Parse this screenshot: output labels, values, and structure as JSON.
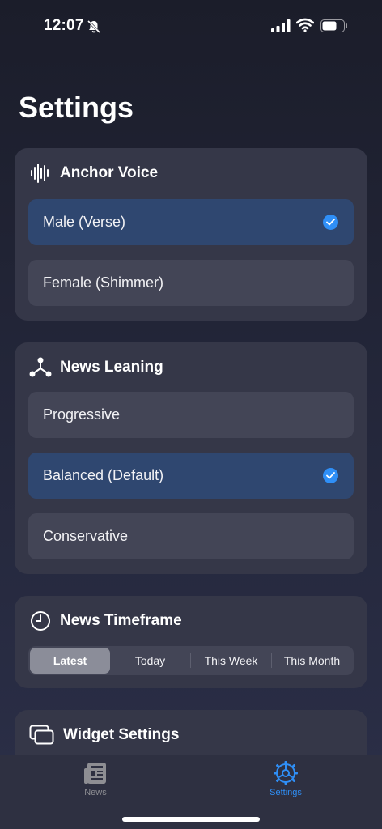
{
  "status_bar": {
    "time": "12:07"
  },
  "title": "Settings",
  "anchor_voice": {
    "title": "Anchor Voice",
    "options": [
      {
        "label": "Male (Verse)",
        "selected": true
      },
      {
        "label": "Female (Shimmer)",
        "selected": false
      }
    ]
  },
  "news_leaning": {
    "title": "News Leaning",
    "options": [
      {
        "label": "Progressive",
        "selected": false
      },
      {
        "label": "Balanced (Default)",
        "selected": true
      },
      {
        "label": "Conservative",
        "selected": false
      }
    ]
  },
  "news_timeframe": {
    "title": "News Timeframe",
    "segments": [
      "Latest",
      "Today",
      "This Week",
      "This Month"
    ],
    "active": "Latest"
  },
  "widget_settings": {
    "title": "Widget Settings"
  },
  "tab_bar": {
    "tabs": [
      {
        "label": "News",
        "icon": "newspaper-icon",
        "active": false
      },
      {
        "label": "Settings",
        "icon": "gear-icon",
        "active": true
      }
    ]
  },
  "colors": {
    "accent": "#2f8ff7",
    "selected_row": "#2f4770",
    "card": "#353748",
    "row": "#434556",
    "inactive_tab": "#8e8e93"
  }
}
